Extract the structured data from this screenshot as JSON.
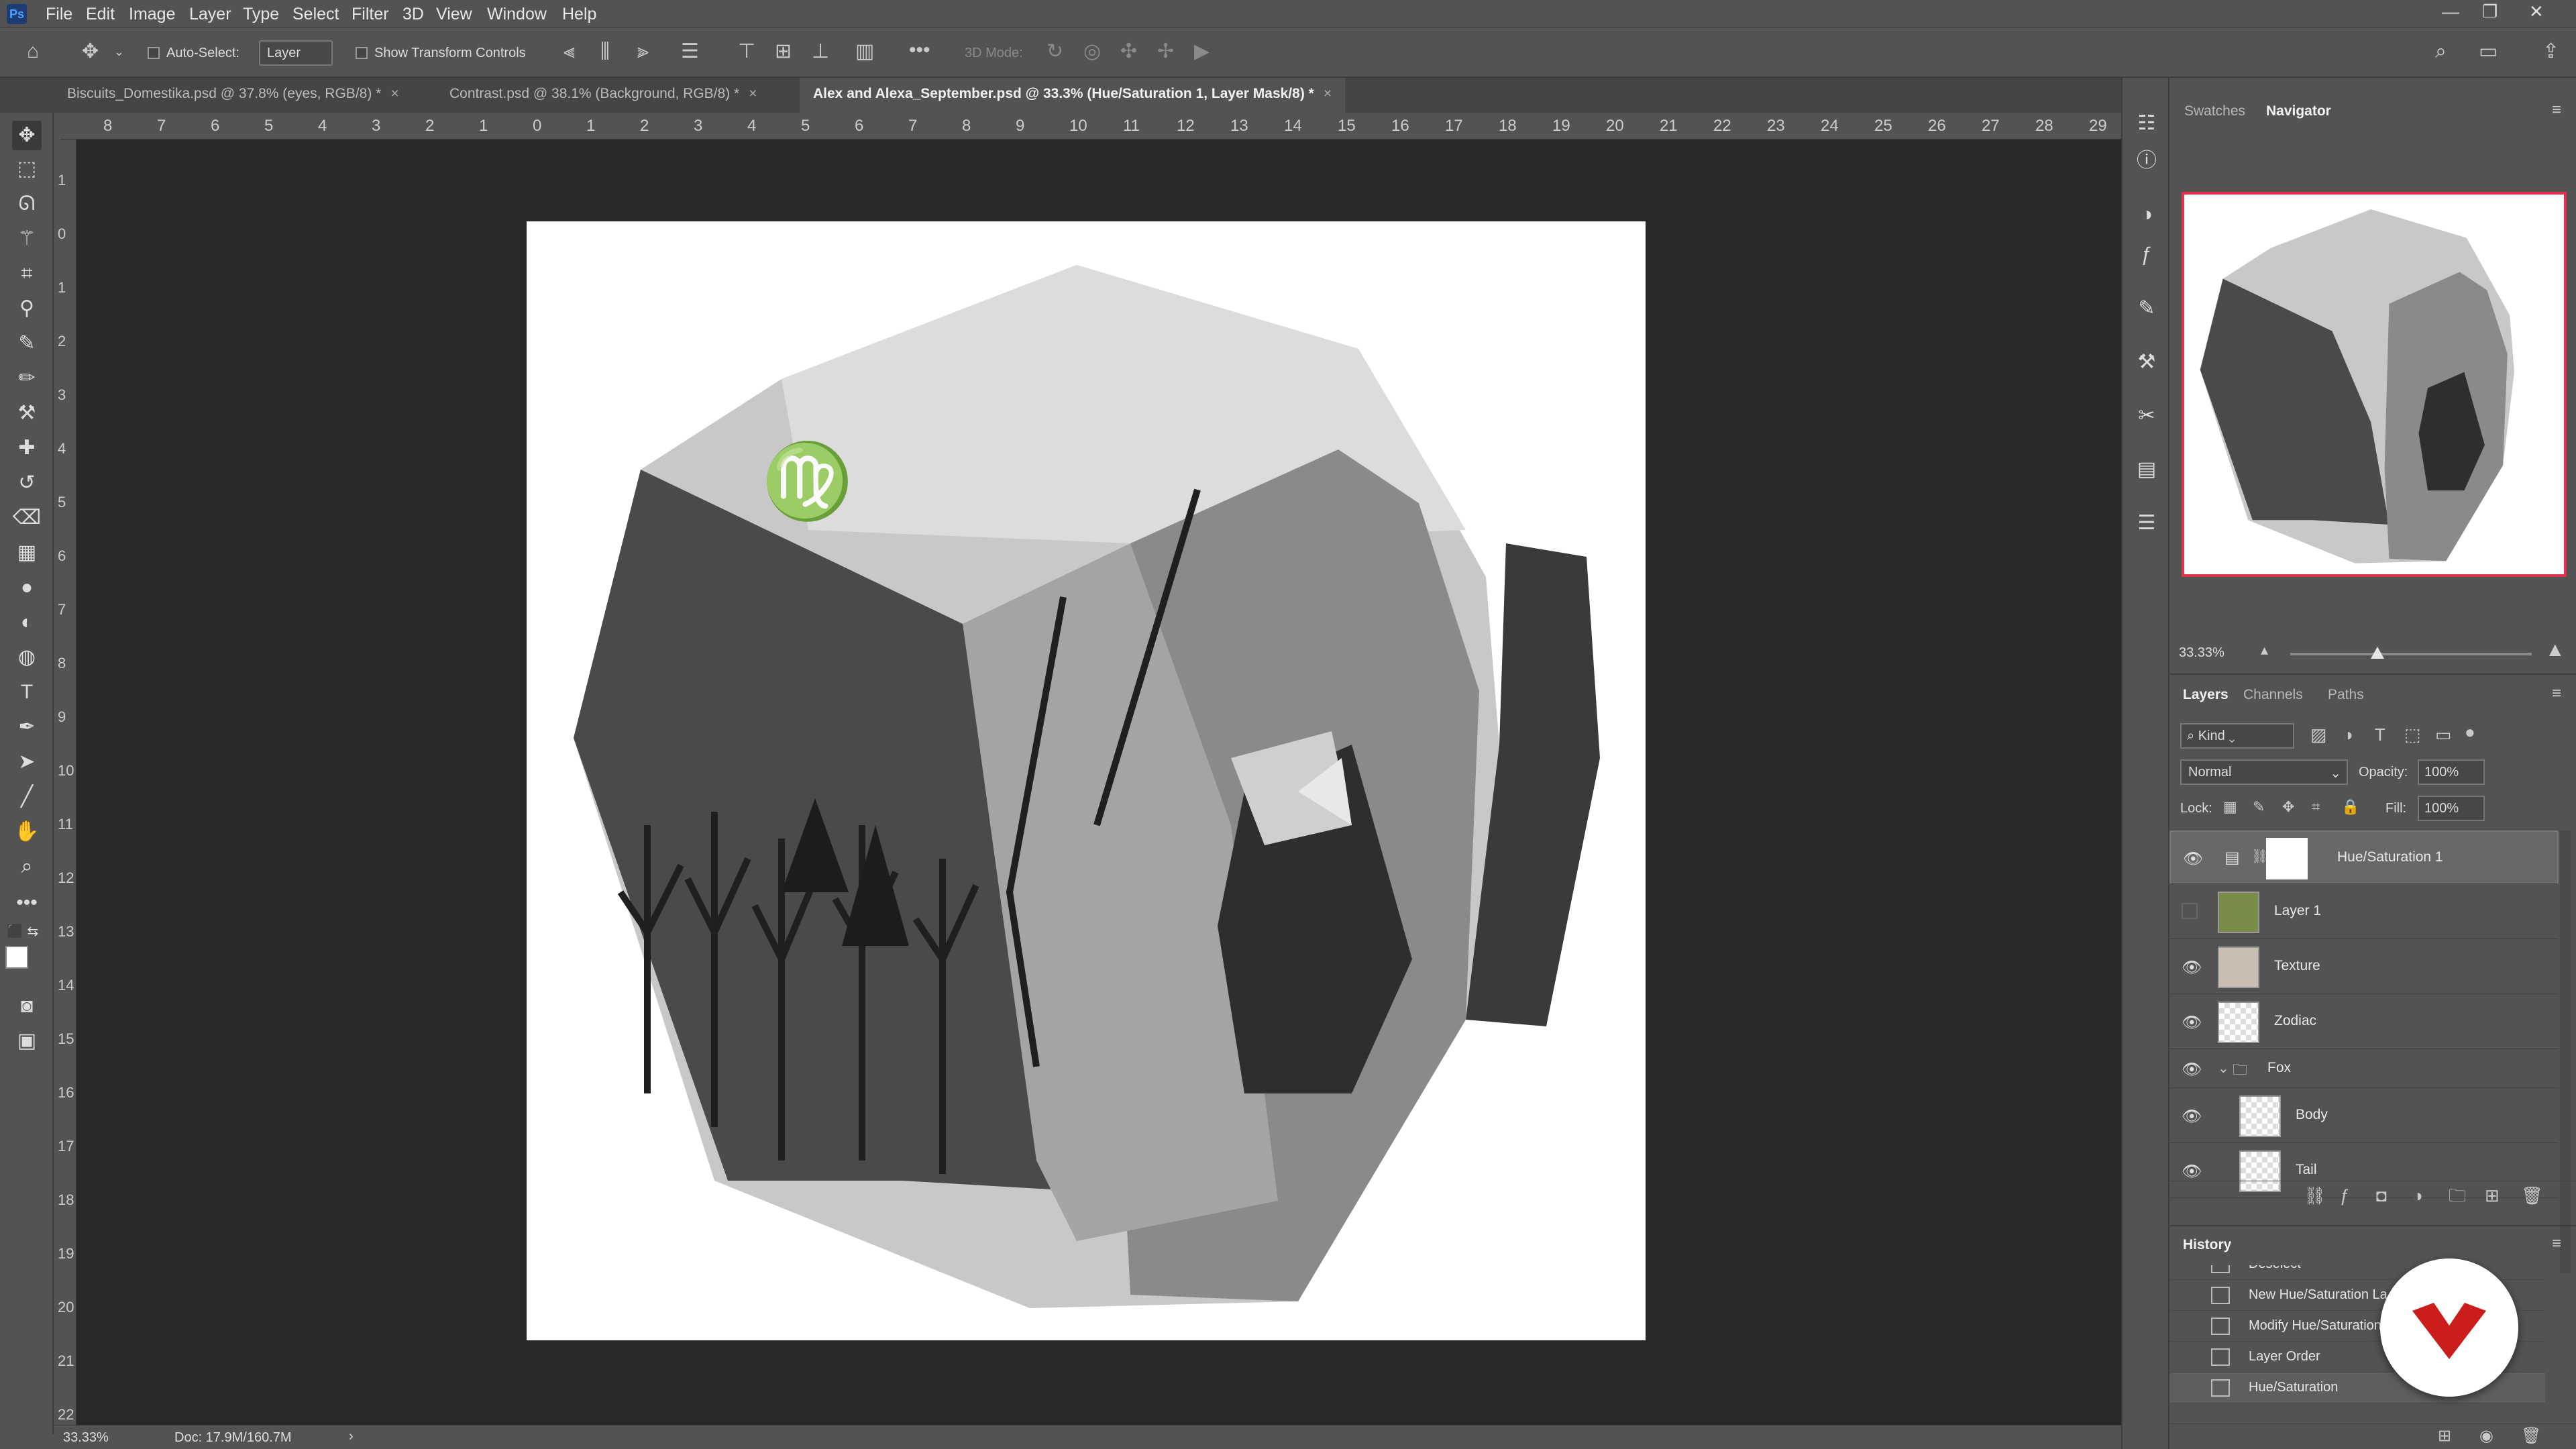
{
  "app": {
    "icon_label": "Ps"
  },
  "menu": [
    "File",
    "Edit",
    "Image",
    "Layer",
    "Type",
    "Select",
    "Filter",
    "3D",
    "View",
    "Window",
    "Help"
  ],
  "options_bar": {
    "auto_select_label": "Auto-Select:",
    "auto_select_value": "Layer",
    "show_transform_label": "Show Transform Controls",
    "mode_3d_label": "3D Mode:"
  },
  "tabs": [
    {
      "label": "Biscuits_Domestika.psd @ 37.8% (eyes, RGB/8) *",
      "close": "×"
    },
    {
      "label": "Contrast.psd @ 38.1% (Background, RGB/8) *",
      "close": "×"
    },
    {
      "label": "Alex and Alexa_September.psd @ 33.3% (Hue/Saturation 1, Layer Mask/8) *",
      "close": "×"
    }
  ],
  "ruler_top": [
    "8",
    "7",
    "6",
    "5",
    "4",
    "3",
    "2",
    "1",
    "0",
    "1",
    "2",
    "3",
    "4",
    "5",
    "6",
    "7",
    "8",
    "9",
    "10",
    "11",
    "12",
    "13",
    "14",
    "15",
    "16",
    "17",
    "18",
    "19",
    "20",
    "21",
    "22",
    "23",
    "24",
    "25",
    "26",
    "27",
    "28",
    "29"
  ],
  "ruler_left": [
    "1",
    "0",
    "1",
    "2",
    "3",
    "4",
    "5",
    "6",
    "7",
    "8",
    "9",
    "10",
    "11",
    "12",
    "13",
    "14",
    "15",
    "16",
    "17",
    "18",
    "19",
    "20",
    "21",
    "22"
  ],
  "status": {
    "zoom": "33.33%",
    "doc": "Doc: 17.9M/160.7M",
    "arrow": "›"
  },
  "panels": {
    "top_tabs": [
      "Swatches",
      "Navigator"
    ],
    "navigator_zoom": "33.33%",
    "layers_tabs": [
      "Layers",
      "Channels",
      "Paths"
    ],
    "filter_kind": "Kind",
    "blend_mode": "Normal",
    "opacity_label": "Opacity:",
    "opacity_value": "100%",
    "lock_label": "Lock:",
    "fill_label": "Fill:",
    "fill_value": "100%",
    "history_title": "History"
  },
  "layers": [
    {
      "name": "Hue/Saturation 1",
      "visible": true
    },
    {
      "name": "Layer 1",
      "visible": false
    },
    {
      "name": "Texture",
      "visible": true
    },
    {
      "name": "Zodiac",
      "visible": true
    },
    {
      "name": "Fox",
      "visible": true
    },
    {
      "name": "Body",
      "visible": true
    },
    {
      "name": "Tail",
      "visible": true
    }
  ],
  "history": [
    "Deselect",
    "New Hue/Saturation La",
    "Modify Hue/Saturation",
    "Layer Order",
    "Hue/Saturation"
  ],
  "colors": {
    "accent_border": "#e0304a",
    "badge": "#cc1d1d"
  }
}
